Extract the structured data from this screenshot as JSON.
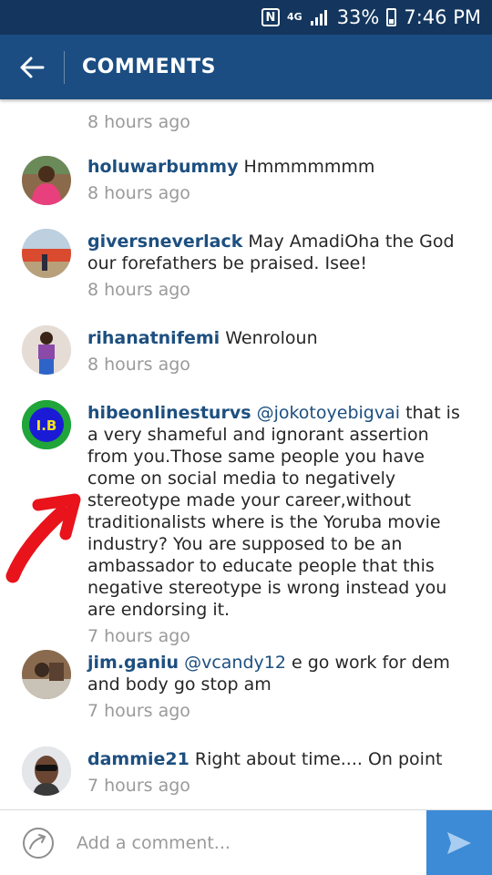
{
  "status_bar": {
    "nfc_icon": "N",
    "network_icon": "4G",
    "battery": "33%",
    "time": "7:46 PM"
  },
  "app_bar": {
    "back_icon": "arrow-back",
    "title": "COMMENTS"
  },
  "colors": {
    "status_bar_bg": "#14365e",
    "app_bar_bg": "#1b4d82",
    "username": "#1d4f80",
    "timestamp": "#9a9a9a",
    "send_button_bg": "#3d8bd6",
    "annotation_arrow": "#e8131b"
  },
  "comments": [
    {
      "username": "",
      "mention": "",
      "text": "",
      "time": "8 hours ago"
    },
    {
      "username": "holuwarbummy",
      "mention": "",
      "text": "Hmmmmmmm",
      "time": "8 hours ago"
    },
    {
      "username": "giversneverlack",
      "mention": "",
      "text": "May AmadiOha the God our forefathers be praised. Isee!",
      "time": "8 hours ago"
    },
    {
      "username": "rihanatnifemi",
      "mention": "",
      "text": "Wenroloun",
      "time": "8 hours ago"
    },
    {
      "username": "hibeonlinesturvs",
      "mention": "@jokotoyebigvai",
      "text": "that is a very shameful and ignorant assertion from you.Those same people you have come on social media to negatively stereotype made your career,without traditionalists where is the Yoruba movie industry? You are supposed to be an ambassador to educate people that this negative stereotype is wrong instead you are endorsing it.",
      "time": "7 hours ago",
      "avatar_label": "I.B"
    },
    {
      "username": "jim.ganiu",
      "mention": "@vcandy12",
      "text": "e go work for dem and body go stop am",
      "time": "7 hours ago"
    },
    {
      "username": "dammie21",
      "mention": "",
      "text": "Right about time.... On point",
      "time": "7 hours ago"
    }
  ],
  "composer": {
    "placeholder": "Add a comment..."
  }
}
